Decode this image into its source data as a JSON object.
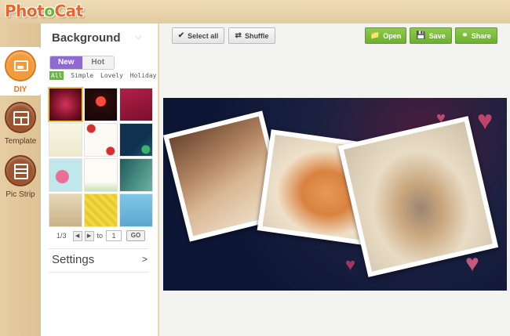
{
  "app": {
    "logo_part1": "Phot",
    "logo_part2": "o",
    "logo_part3": "Cat"
  },
  "rail": {
    "items": [
      {
        "label": "DIY",
        "icon": "picture-icon",
        "active": true
      },
      {
        "label": "Template",
        "icon": "template-icon",
        "active": false
      },
      {
        "label": "Pic Strip",
        "icon": "pic-strip-icon",
        "active": false
      }
    ]
  },
  "panel": {
    "title": "Background",
    "tabs": [
      {
        "label": "New",
        "active": true
      },
      {
        "label": "Hot",
        "active": false
      }
    ],
    "filters": [
      "All",
      "Simple",
      "Lovely",
      "Holiday"
    ],
    "active_filter": "All",
    "pager": {
      "page_text": "1/3",
      "to_label": "to",
      "page_value": "1",
      "go_label": "GO"
    },
    "settings_label": "Settings",
    "settings_arrow": ">"
  },
  "toolbar": {
    "select_all_label": "Select all",
    "shuffle_label": "Shuffle",
    "open_label": "Open",
    "save_label": "Save",
    "share_label": "Share"
  },
  "colors": {
    "accent_purple": "#8e6ad0",
    "accent_green": "#6cb02c",
    "rail_active": "#f39a3b",
    "canvas_bg": "#0e1636"
  }
}
